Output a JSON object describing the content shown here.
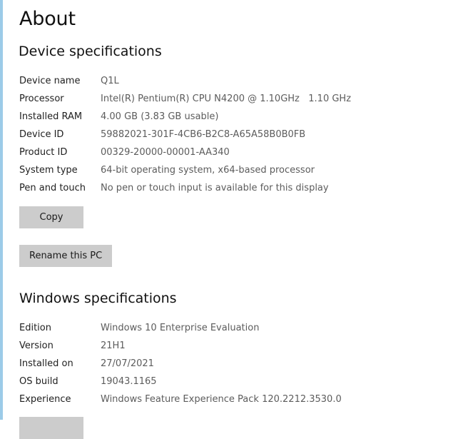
{
  "page": {
    "title": "About"
  },
  "device_specifications": {
    "heading": "Device specifications",
    "rows": [
      {
        "label": "Device name",
        "value": "Q1L"
      },
      {
        "label": "Processor",
        "value": "Intel(R) Pentium(R) CPU N4200 @ 1.10GHz   1.10 GHz"
      },
      {
        "label": "Installed RAM",
        "value": "4.00 GB (3.83 GB usable)"
      },
      {
        "label": "Device ID",
        "value": "59882021-301F-4CB6-B2C8-A65A58B0B0FB"
      },
      {
        "label": "Product ID",
        "value": "00329-20000-00001-AA340"
      },
      {
        "label": "System type",
        "value": "64-bit operating system, x64-based processor"
      },
      {
        "label": "Pen and touch",
        "value": "No pen or touch input is available for this display"
      }
    ],
    "copy_label": "Copy",
    "rename_label": "Rename this PC"
  },
  "windows_specifications": {
    "heading": "Windows specifications",
    "rows": [
      {
        "label": "Edition",
        "value": "Windows 10 Enterprise Evaluation"
      },
      {
        "label": "Version",
        "value": "21H1"
      },
      {
        "label": "Installed on",
        "value": "27/07/2021"
      },
      {
        "label": "OS build",
        "value": "19043.1165"
      },
      {
        "label": "Experience",
        "value": "Windows Feature Experience Pack 120.2212.3530.0"
      }
    ]
  },
  "colors": {
    "accent_strip": "#9ccbe8",
    "button_background": "#cccccc",
    "value_text": "#5c5c5c"
  }
}
